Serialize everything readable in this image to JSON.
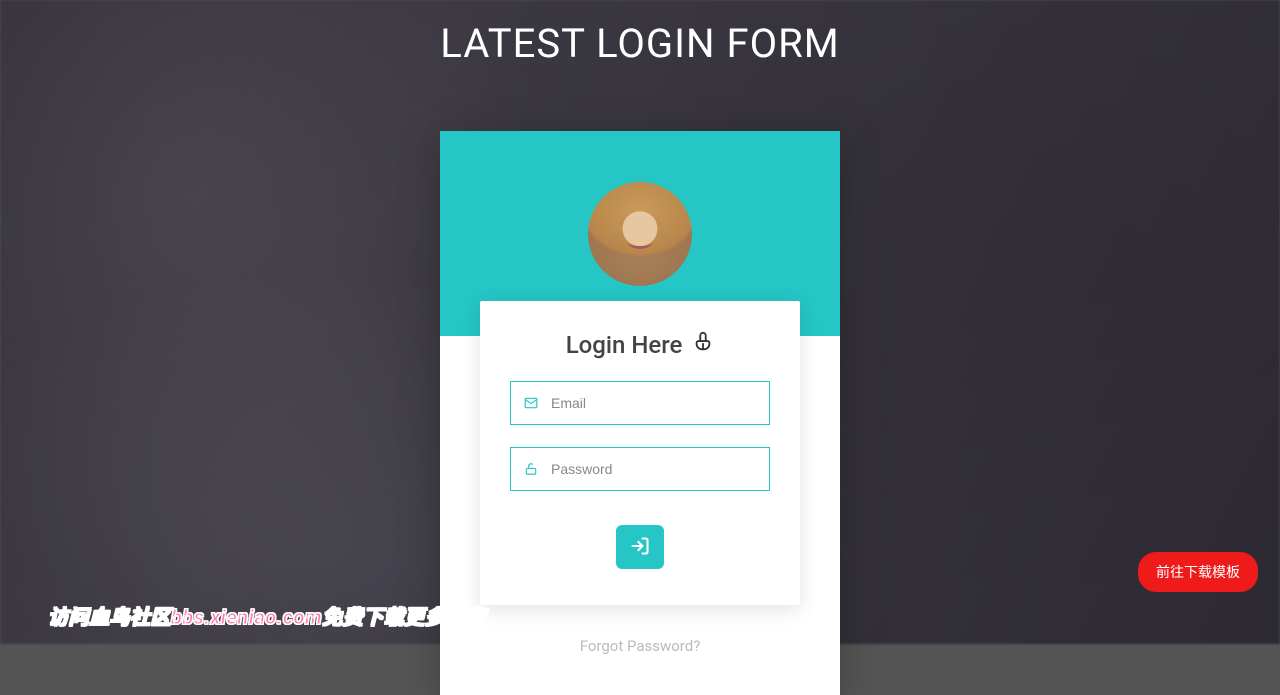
{
  "page": {
    "title": "LATEST LOGIN FORM"
  },
  "form": {
    "heading": "Login Here",
    "email_placeholder": "Email",
    "password_placeholder": "Password",
    "forgot_label": "Forgot Password?"
  },
  "download_button": {
    "label": "前往下载模板"
  },
  "watermark": {
    "text": "访问血鸟社区bbs.xieniao.com免费下载更多内容"
  },
  "icons": {
    "envelope": "envelope-icon",
    "unlock": "unlock-icon",
    "hand": "hand-point-down-icon",
    "signin": "sign-in-icon"
  },
  "colors": {
    "accent": "#26c6c6",
    "danger": "#ef1b1b"
  }
}
